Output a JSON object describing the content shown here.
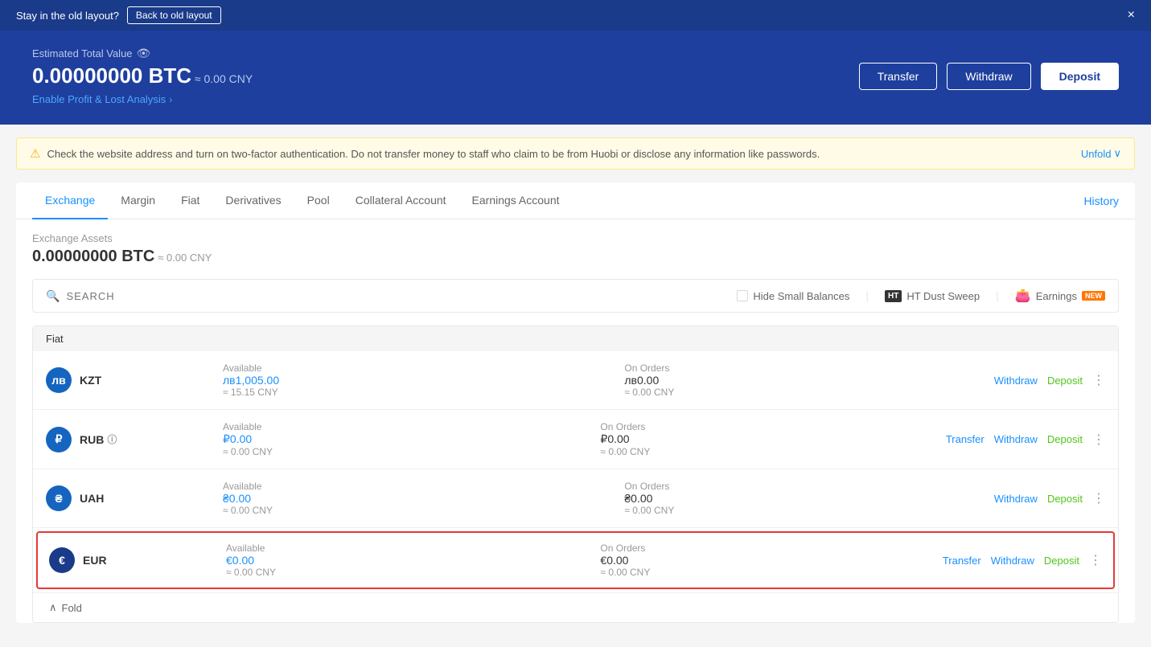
{
  "topbar": {
    "stay_text": "Stay in the old layout?",
    "back_btn": "Back to old layout",
    "close_icon": "×"
  },
  "header": {
    "estimated_label": "Estimated Total Value",
    "btc_amount": "0.00000000 BTC",
    "approx_cny": "≈ 0.00 CNY",
    "enable_link": "Enable Profit & Lost Analysis",
    "btn_transfer": "Transfer",
    "btn_withdraw": "Withdraw",
    "btn_deposit": "Deposit"
  },
  "warning": {
    "text": "Check the website address and turn on two-factor authentication. Do not transfer money to staff who claim to be from Huobi or disclose any information like passwords.",
    "unfold": "Unfold"
  },
  "tabs": [
    {
      "label": "Exchange",
      "active": true
    },
    {
      "label": "Margin",
      "active": false
    },
    {
      "label": "Fiat",
      "active": false
    },
    {
      "label": "Derivatives",
      "active": false
    },
    {
      "label": "Pool",
      "active": false
    },
    {
      "label": "Collateral Account",
      "active": false
    },
    {
      "label": "Earnings Account",
      "active": false
    }
  ],
  "history_label": "History",
  "assets": {
    "label": "Exchange Assets",
    "amount": "0.00000000 BTC",
    "cny": "≈ 0.00 CNY"
  },
  "controls": {
    "search_placeholder": "SEARCH",
    "hide_small": "Hide Small Balances",
    "ht_dust": "HT Dust Sweep",
    "earnings": "Earnings",
    "new_badge": "NEW"
  },
  "fiat_header": "Fiat",
  "coins": [
    {
      "symbol": "KZT",
      "logo_text": "лв",
      "available_label": "Available",
      "available_amount": "лв1,005.00",
      "available_cny": "≈ 15.15 CNY",
      "orders_label": "On Orders",
      "orders_amount": "лв0.00",
      "orders_cny": "≈ 0.00 CNY",
      "actions": [
        "Withdraw",
        "Deposit"
      ],
      "has_transfer": false,
      "highlighted": false
    },
    {
      "symbol": "RUB",
      "logo_text": "₽",
      "available_label": "Available",
      "available_amount": "₽0.00",
      "available_cny": "≈ 0.00 CNY",
      "orders_label": "On Orders",
      "orders_amount": "₽0.00",
      "orders_cny": "≈ 0.00 CNY",
      "actions": [
        "Transfer",
        "Withdraw",
        "Deposit"
      ],
      "has_info": true,
      "highlighted": false
    },
    {
      "symbol": "UAH",
      "logo_text": "₴",
      "available_label": "Available",
      "available_amount": "₴0.00",
      "available_cny": "≈ 0.00 CNY",
      "orders_label": "On Orders",
      "orders_amount": "₴0.00",
      "orders_cny": "≈ 0.00 CNY",
      "actions": [
        "Withdraw",
        "Deposit"
      ],
      "highlighted": false
    },
    {
      "symbol": "EUR",
      "logo_text": "€",
      "available_label": "Available",
      "available_amount": "€0.00",
      "available_cny": "≈ 0.00 CNY",
      "orders_label": "On Orders",
      "orders_amount": "€0.00",
      "orders_cny": "≈ 0.00 CNY",
      "actions": [
        "Transfer",
        "Withdraw",
        "Deposit"
      ],
      "highlighted": true
    }
  ],
  "fold_label": "Fold"
}
